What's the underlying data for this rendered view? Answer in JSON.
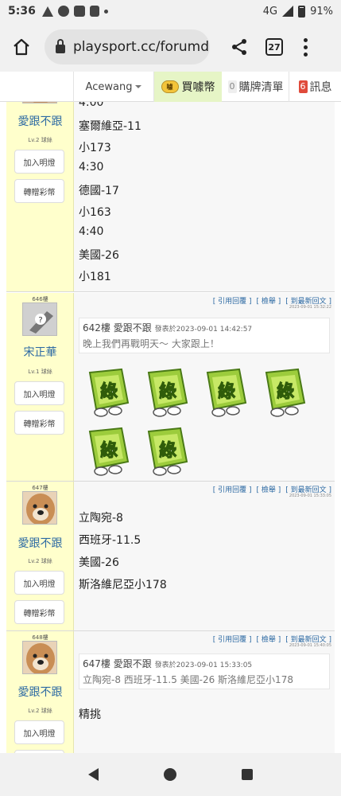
{
  "status": {
    "time": "5:36",
    "network": "4G",
    "battery": "91%"
  },
  "browser": {
    "url": "playsport.cc/forumd",
    "tab_count": "27"
  },
  "site": {
    "user": "Acewang",
    "buy_label": "買噱幣",
    "coin_icon_text": "噱",
    "cart_count": "0",
    "cart_label": "購牌清單",
    "msg_count": "6",
    "msg_label": "訊息"
  },
  "labels": {
    "add_light": "加入明燈",
    "gift": "轉贈彩幣",
    "reply_quote": "[ 引用回覆 ]",
    "report": "[ 檢舉 ]",
    "latest": "[ 到最新回文 ]"
  },
  "posts": [
    {
      "user": "愛跟不跟",
      "level": "Lv.2 球絲",
      "lines": [
        "4:00",
        "塞爾維亞-11",
        "小173",
        "4:30",
        "德國-17",
        "小163",
        "4:40",
        "美國-26",
        "小181"
      ]
    },
    {
      "floor": "646樓",
      "user": "宋正華",
      "level": "Lv.1 球絲",
      "time": "2023-09-01 15:32:22",
      "quote_head": "642樓 愛跟不跟",
      "quote_time": "發表於2023-09-01 14:42:57",
      "quote_body": "晚上我們再戰明天～ 大家跟上！",
      "stickers": [
        "綠",
        "綠",
        "綠",
        "綠",
        "綠",
        "綠"
      ]
    },
    {
      "floor": "647樓",
      "user": "愛跟不跟",
      "level": "Lv.2 球絲",
      "time": "2023-09-01 15:33:05",
      "lines": [
        "立陶宛-8",
        "西班牙-11.5",
        "美國-26",
        "斯洛維尼亞小178"
      ]
    },
    {
      "floor": "648樓",
      "user": "愛跟不跟",
      "level": "Lv.2 球絲",
      "time": "2023-09-01 15:40:05",
      "quote_head": "647樓 愛跟不跟",
      "quote_time": "發表於2023-09-01 15:33:05",
      "quote_body": "立陶宛-8 西班牙-11.5 美國-26 斯洛維尼亞小178",
      "lines": [
        "精挑"
      ]
    }
  ]
}
